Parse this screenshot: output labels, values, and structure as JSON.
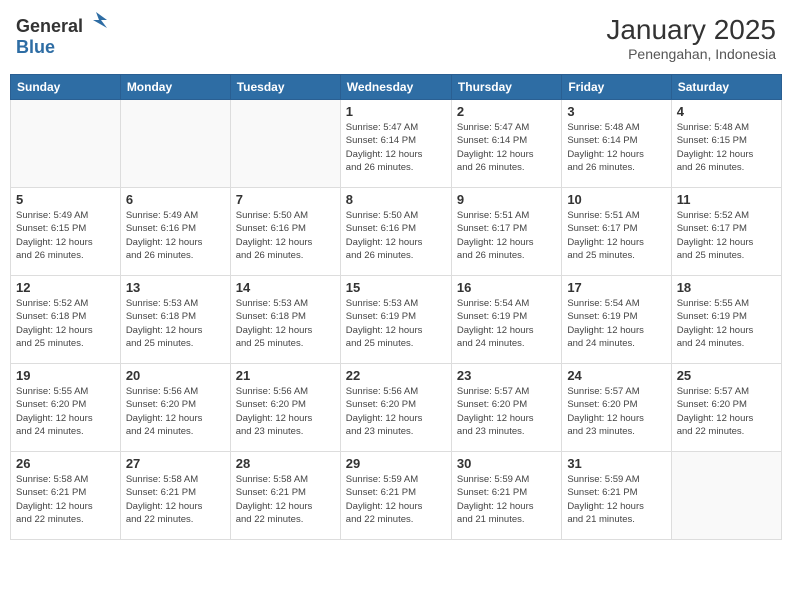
{
  "header": {
    "logo_general": "General",
    "logo_blue": "Blue",
    "month": "January 2025",
    "location": "Penengahan, Indonesia"
  },
  "days_of_week": [
    "Sunday",
    "Monday",
    "Tuesday",
    "Wednesday",
    "Thursday",
    "Friday",
    "Saturday"
  ],
  "weeks": [
    [
      {
        "day": "",
        "info": ""
      },
      {
        "day": "",
        "info": ""
      },
      {
        "day": "",
        "info": ""
      },
      {
        "day": "1",
        "info": "Sunrise: 5:47 AM\nSunset: 6:14 PM\nDaylight: 12 hours\nand 26 minutes."
      },
      {
        "day": "2",
        "info": "Sunrise: 5:47 AM\nSunset: 6:14 PM\nDaylight: 12 hours\nand 26 minutes."
      },
      {
        "day": "3",
        "info": "Sunrise: 5:48 AM\nSunset: 6:14 PM\nDaylight: 12 hours\nand 26 minutes."
      },
      {
        "day": "4",
        "info": "Sunrise: 5:48 AM\nSunset: 6:15 PM\nDaylight: 12 hours\nand 26 minutes."
      }
    ],
    [
      {
        "day": "5",
        "info": "Sunrise: 5:49 AM\nSunset: 6:15 PM\nDaylight: 12 hours\nand 26 minutes."
      },
      {
        "day": "6",
        "info": "Sunrise: 5:49 AM\nSunset: 6:16 PM\nDaylight: 12 hours\nand 26 minutes."
      },
      {
        "day": "7",
        "info": "Sunrise: 5:50 AM\nSunset: 6:16 PM\nDaylight: 12 hours\nand 26 minutes."
      },
      {
        "day": "8",
        "info": "Sunrise: 5:50 AM\nSunset: 6:16 PM\nDaylight: 12 hours\nand 26 minutes."
      },
      {
        "day": "9",
        "info": "Sunrise: 5:51 AM\nSunset: 6:17 PM\nDaylight: 12 hours\nand 26 minutes."
      },
      {
        "day": "10",
        "info": "Sunrise: 5:51 AM\nSunset: 6:17 PM\nDaylight: 12 hours\nand 25 minutes."
      },
      {
        "day": "11",
        "info": "Sunrise: 5:52 AM\nSunset: 6:17 PM\nDaylight: 12 hours\nand 25 minutes."
      }
    ],
    [
      {
        "day": "12",
        "info": "Sunrise: 5:52 AM\nSunset: 6:18 PM\nDaylight: 12 hours\nand 25 minutes."
      },
      {
        "day": "13",
        "info": "Sunrise: 5:53 AM\nSunset: 6:18 PM\nDaylight: 12 hours\nand 25 minutes."
      },
      {
        "day": "14",
        "info": "Sunrise: 5:53 AM\nSunset: 6:18 PM\nDaylight: 12 hours\nand 25 minutes."
      },
      {
        "day": "15",
        "info": "Sunrise: 5:53 AM\nSunset: 6:19 PM\nDaylight: 12 hours\nand 25 minutes."
      },
      {
        "day": "16",
        "info": "Sunrise: 5:54 AM\nSunset: 6:19 PM\nDaylight: 12 hours\nand 24 minutes."
      },
      {
        "day": "17",
        "info": "Sunrise: 5:54 AM\nSunset: 6:19 PM\nDaylight: 12 hours\nand 24 minutes."
      },
      {
        "day": "18",
        "info": "Sunrise: 5:55 AM\nSunset: 6:19 PM\nDaylight: 12 hours\nand 24 minutes."
      }
    ],
    [
      {
        "day": "19",
        "info": "Sunrise: 5:55 AM\nSunset: 6:20 PM\nDaylight: 12 hours\nand 24 minutes."
      },
      {
        "day": "20",
        "info": "Sunrise: 5:56 AM\nSunset: 6:20 PM\nDaylight: 12 hours\nand 24 minutes."
      },
      {
        "day": "21",
        "info": "Sunrise: 5:56 AM\nSunset: 6:20 PM\nDaylight: 12 hours\nand 23 minutes."
      },
      {
        "day": "22",
        "info": "Sunrise: 5:56 AM\nSunset: 6:20 PM\nDaylight: 12 hours\nand 23 minutes."
      },
      {
        "day": "23",
        "info": "Sunrise: 5:57 AM\nSunset: 6:20 PM\nDaylight: 12 hours\nand 23 minutes."
      },
      {
        "day": "24",
        "info": "Sunrise: 5:57 AM\nSunset: 6:20 PM\nDaylight: 12 hours\nand 23 minutes."
      },
      {
        "day": "25",
        "info": "Sunrise: 5:57 AM\nSunset: 6:20 PM\nDaylight: 12 hours\nand 22 minutes."
      }
    ],
    [
      {
        "day": "26",
        "info": "Sunrise: 5:58 AM\nSunset: 6:21 PM\nDaylight: 12 hours\nand 22 minutes."
      },
      {
        "day": "27",
        "info": "Sunrise: 5:58 AM\nSunset: 6:21 PM\nDaylight: 12 hours\nand 22 minutes."
      },
      {
        "day": "28",
        "info": "Sunrise: 5:58 AM\nSunset: 6:21 PM\nDaylight: 12 hours\nand 22 minutes."
      },
      {
        "day": "29",
        "info": "Sunrise: 5:59 AM\nSunset: 6:21 PM\nDaylight: 12 hours\nand 22 minutes."
      },
      {
        "day": "30",
        "info": "Sunrise: 5:59 AM\nSunset: 6:21 PM\nDaylight: 12 hours\nand 21 minutes."
      },
      {
        "day": "31",
        "info": "Sunrise: 5:59 AM\nSunset: 6:21 PM\nDaylight: 12 hours\nand 21 minutes."
      },
      {
        "day": "",
        "info": ""
      }
    ]
  ]
}
